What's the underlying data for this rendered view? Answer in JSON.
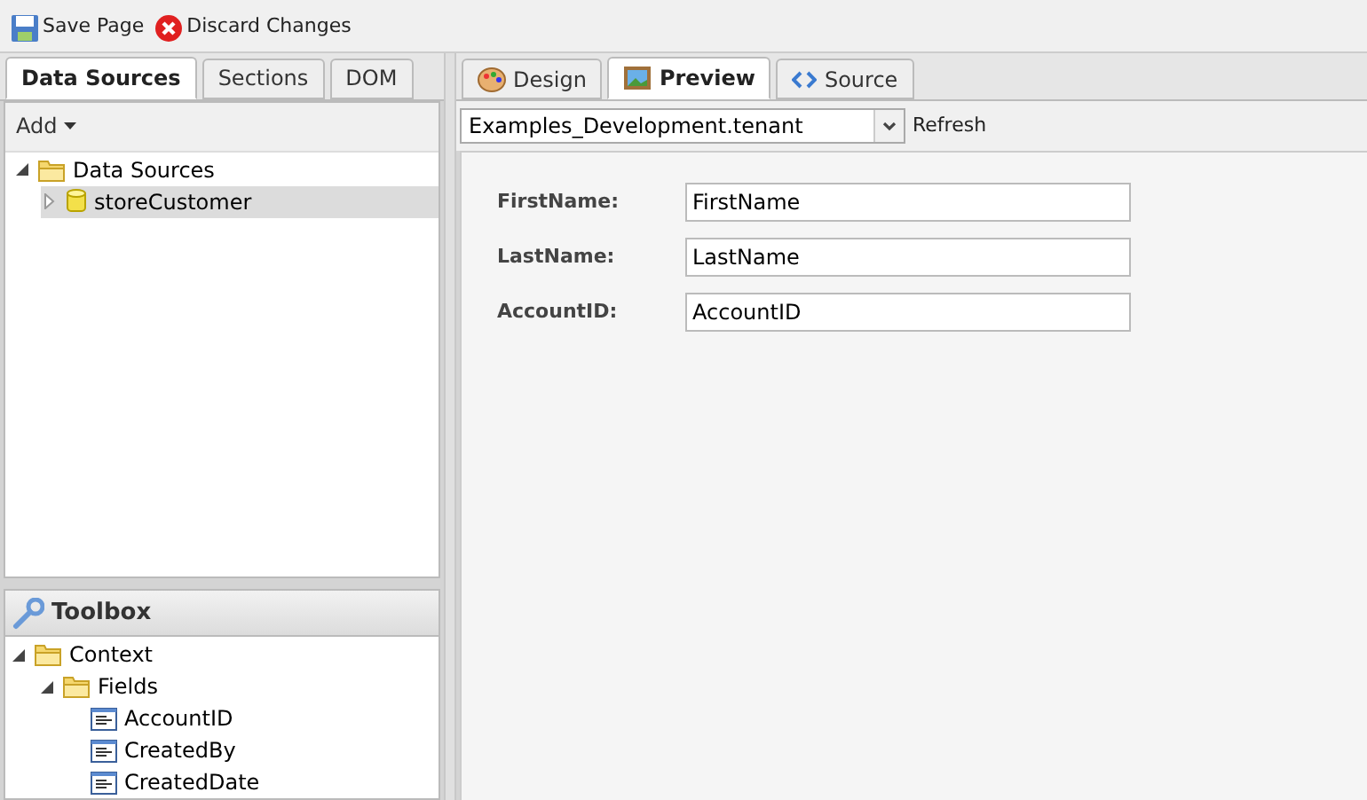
{
  "toolbar": [
    {
      "label": "Save Page",
      "kind": "save"
    },
    {
      "label": "Discard Changes",
      "kind": "discard"
    }
  ],
  "left_tabs": [
    {
      "label": "Data Sources",
      "selected": true
    },
    {
      "label": "Sections",
      "selected": false
    },
    {
      "label": "DOM",
      "selected": false
    }
  ],
  "add_menu": {
    "label": "Add"
  },
  "data_sources_tree": [
    {
      "label": "Data Sources",
      "kind": "folder",
      "expanded": true,
      "selected": false,
      "children": [
        {
          "label": "storeCustomer",
          "kind": "database",
          "expanded": false,
          "selected": true
        }
      ]
    }
  ],
  "toolbox": {
    "title": "Toolbox",
    "tree": [
      {
        "label": "Context",
        "kind": "folder",
        "expanded": true,
        "selected": false,
        "children": [
          {
            "label": "Fields",
            "kind": "folder",
            "expanded": true,
            "selected": false,
            "children": [
              {
                "label": "AccountID",
                "kind": "field",
                "selected": false
              },
              {
                "label": "CreatedBy",
                "kind": "field",
                "selected": false
              },
              {
                "label": "CreatedDate",
                "kind": "field",
                "selected": false
              }
            ]
          }
        ]
      }
    ]
  },
  "right_tabs": [
    {
      "label": "Design",
      "kind": "design",
      "selected": false
    },
    {
      "label": "Preview",
      "kind": "preview",
      "selected": true
    },
    {
      "label": "Source",
      "kind": "source",
      "selected": false
    }
  ],
  "tenant_select": {
    "value": "Examples_Development.tenant"
  },
  "refresh": {
    "label": "Refresh"
  },
  "form": [
    {
      "label": "FirstName:",
      "value": "FirstName"
    },
    {
      "label": "LastName:",
      "value": "LastName"
    },
    {
      "label": "AccountID:",
      "value": "AccountID"
    }
  ]
}
